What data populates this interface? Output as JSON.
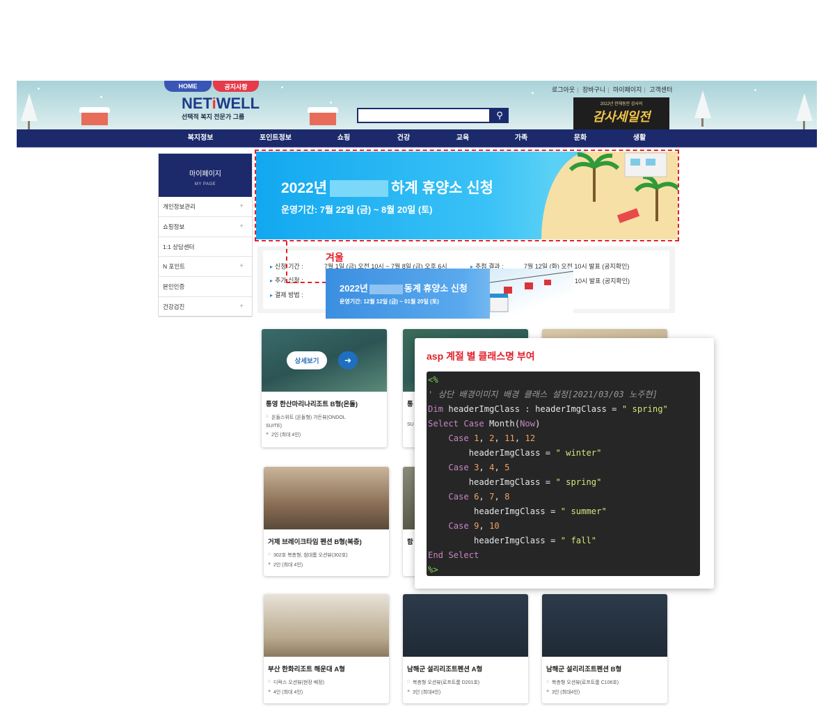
{
  "header": {
    "home_tab": "HOME",
    "notice_tab": "공지사항",
    "logo_main_prefix": "NET",
    "logo_main_i": "i",
    "logo_main_suffix": "WELL",
    "logo_sub": "선택적 복지 전문가 그룹",
    "util_links": [
      "로그아웃",
      "장바구니",
      "마이페이지",
      "고객센터"
    ],
    "search_placeholder": "",
    "search_icon": "search-icon",
    "sale_sub": "2022년 한해동안 감사의",
    "sale_title": "감사세일전"
  },
  "gnb": [
    "복지정보",
    "포인트정보",
    "쇼핑",
    "건강",
    "교육",
    "가족",
    "문화",
    "생활"
  ],
  "sidebar": {
    "title": "마이페이지",
    "subtitle": "MY PAGE",
    "items": [
      {
        "label": "개인정보관리",
        "plus": "+"
      },
      {
        "label": "쇼핑정보",
        "plus": "+"
      },
      {
        "label": "1:1 상담센터",
        "plus": ""
      },
      {
        "label": "N 포인트",
        "plus": "+"
      },
      {
        "label": "본인인증",
        "plus": ""
      },
      {
        "label": "건강검진",
        "plus": "+"
      }
    ]
  },
  "summer_banner": {
    "title_prefix": "2022년",
    "title_suffix": "하계 휴양소 신청",
    "period": "운영기간: 7월 22일 (금) ~ 8월 20일 (토)"
  },
  "info": {
    "rows": [
      {
        "label": "신청 기간 :",
        "value": "7월 1일 (금) 오전 10시 ~ 7월 8일 (금) 오후 6시"
      },
      {
        "label": "추가 신청 :",
        "value": ""
      },
      {
        "label": "결제 방법 :",
        "value": ""
      }
    ],
    "right_rows": [
      {
        "label": "추첨 결과 :",
        "value": "7월 12일 (화) 오전 10시 발표 (공지확인)"
      },
      {
        "label": "",
        "value": "10시 발표 (공지확인)"
      }
    ]
  },
  "annotation": {
    "winter_label": "겨울"
  },
  "winter_banner": {
    "title_prefix": "2022년",
    "title_suffix": "동계 휴양소 신청",
    "period": "운영기간: 12월 12일 (금) ~ 01월 20일 (토)"
  },
  "cards": [
    {
      "title": "통영 한산마리나리조트 B형(온돌)",
      "room": "온돌스위트 (온돌형) 가든뷰(ONDOL",
      "room2": "SUITE)",
      "people": "2인 (최대 4인)",
      "detail_label": "상세보기"
    },
    {
      "title": "통",
      "room": "",
      "room2": "SU",
      "people": ""
    },
    {
      "title": "",
      "room": "",
      "room2": "",
      "people": ""
    },
    {
      "title": "거제 브레이크타임 펜션 B형(복층)",
      "room": "302호 복층형, 침대룸 오션뷰(302호)",
      "room2": "",
      "people": "2인 (최대 4인)"
    },
    {
      "title": "함",
      "room": "",
      "room2": "",
      "people": ""
    },
    {
      "title": "부산 한화리조트 해운대 A형",
      "room": "디럭스 오션뷰(현장 배정)",
      "room2": "",
      "people": "4인 (최대 4인)"
    },
    {
      "title": "남해군 설리리조트펜션 A형",
      "room": "복층형 오션뷰(로프트룸 D201호)",
      "room2": "",
      "people": "3인 (최대4인)"
    },
    {
      "title": "남해군 설리리조트펜션 B형",
      "room": "복층형 오션뷰(로프트룸 C106호)",
      "room2": "",
      "people": "3인 (최대4인)"
    }
  ],
  "code_panel": {
    "title": "asp 계절 별 클래스명 부여"
  },
  "colors": {
    "navy": "#1c2a6b",
    "accent_red": "#e0202a",
    "banner_blue": "#12a8f0"
  }
}
